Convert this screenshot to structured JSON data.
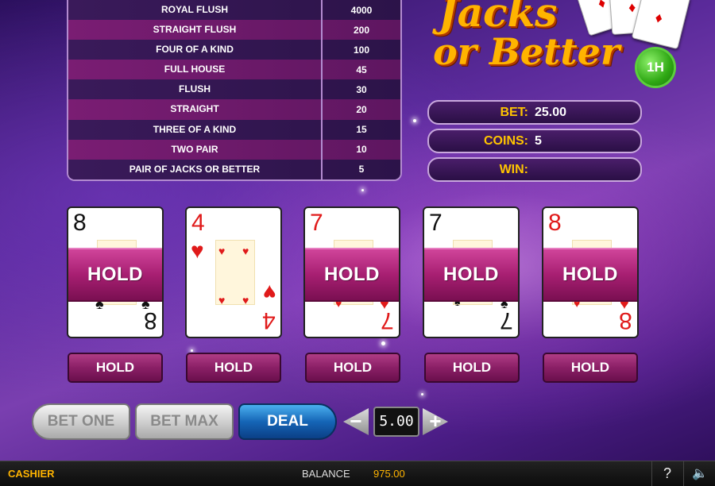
{
  "paytable": {
    "rows": [
      {
        "hand": "ROYAL FLUSH",
        "pay": "4000"
      },
      {
        "hand": "STRAIGHT FLUSH",
        "pay": "200"
      },
      {
        "hand": "FOUR OF A KIND",
        "pay": "100"
      },
      {
        "hand": "FULL HOUSE",
        "pay": "45"
      },
      {
        "hand": "FLUSH",
        "pay": "30"
      },
      {
        "hand": "STRAIGHT",
        "pay": "20"
      },
      {
        "hand": "THREE OF A KIND",
        "pay": "15"
      },
      {
        "hand": "TWO PAIR",
        "pay": "10"
      },
      {
        "hand": "PAIR OF  JACKS OR BETTER",
        "pay": "5"
      }
    ]
  },
  "logo": {
    "line1": "Jacks",
    "line2": "or Better",
    "badge": "1H"
  },
  "info": {
    "bet_label": "BET:",
    "bet_value": "25.00",
    "coins_label": "COINS:",
    "coins_value": "5",
    "win_label": "WIN:",
    "win_value": ""
  },
  "cards": [
    {
      "rank": "8",
      "suit": "♠",
      "color": "black",
      "held": true,
      "hold_label": "HOLD"
    },
    {
      "rank": "4",
      "suit": "♥",
      "color": "red",
      "held": false,
      "hold_label": "HOLD"
    },
    {
      "rank": "7",
      "suit": "♥",
      "color": "red",
      "held": true,
      "hold_label": "HOLD"
    },
    {
      "rank": "7",
      "suit": "♠",
      "color": "black",
      "held": true,
      "hold_label": "HOLD"
    },
    {
      "rank": "8",
      "suit": "♥",
      "color": "red",
      "held": true,
      "hold_label": "HOLD"
    }
  ],
  "hold_buttons": [
    "HOLD",
    "HOLD",
    "HOLD",
    "HOLD",
    "HOLD"
  ],
  "controls": {
    "bet_one": "BET ONE",
    "bet_max": "BET MAX",
    "deal": "DEAL",
    "coin_value": "5.00",
    "decrease_symbol": "−",
    "increase_symbol": "+"
  },
  "bottom_bar": {
    "cashier": "CASHIER",
    "balance_label": "BALANCE",
    "balance_value": "975.00",
    "help_symbol": "?",
    "sound_symbol": "🔈"
  }
}
